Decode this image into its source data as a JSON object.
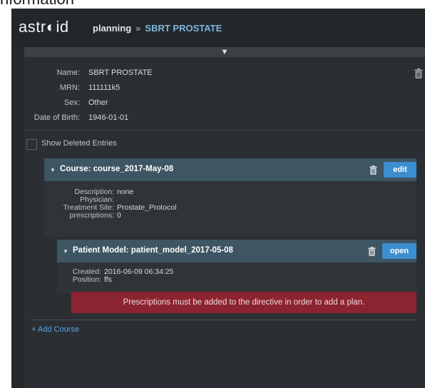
{
  "page_heading": "nformation",
  "app": {
    "logo": "astr◐id",
    "breadcrumb": {
      "parent": "planning",
      "separator": "»",
      "current": "SBRT PROSTATE"
    },
    "collapse_icon": "triangle-down-icon"
  },
  "patient": [
    {
      "label": "Name:",
      "value": "SBRT PROSTATE"
    },
    {
      "label": "MRN:",
      "value": "111111k5"
    },
    {
      "label": "Sex:",
      "value": "Other"
    },
    {
      "label": "Date of Birth:",
      "value": "1946-01-01"
    }
  ],
  "show_deleted": {
    "label": "Show Deleted Entries",
    "checked": false
  },
  "course": {
    "title": "Course: course_2017-May-08",
    "edit_label": "edit",
    "details": [
      {
        "label": "Description:",
        "value": "none"
      },
      {
        "label": "Physician:",
        "value": ""
      },
      {
        "label": "Treatment Site:",
        "value": "Prostate_Protocol"
      },
      {
        "label": "prescriptions:",
        "value": "0"
      }
    ]
  },
  "patient_model": {
    "title": "Patient Model: patient_model_2017-05-08",
    "open_label": "open",
    "details": [
      {
        "label": "Created:",
        "value": "2016-06-09 06:34:25"
      },
      {
        "label": "Position:",
        "value": "ffs"
      }
    ]
  },
  "alert": "Prescriptions must be added to the directive in order to add a plan.",
  "add_course": "+ Add Course",
  "colors": {
    "accent": "#3b8ed0",
    "header_bg": "#3e5563",
    "alert_bg": "#8b2331",
    "link": "#5aa6e8"
  }
}
